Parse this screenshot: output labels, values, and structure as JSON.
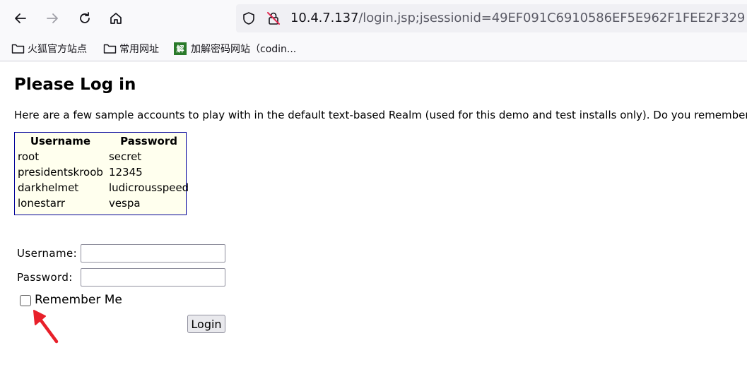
{
  "browser": {
    "url_host": "10.4.7.137",
    "url_path": "/login.jsp;jsessionid=49EF091C6910586EF5E962F1FEE2F329",
    "bookmarks": [
      {
        "label": "火狐官方站点",
        "icon": "folder-icon"
      },
      {
        "label": "常用网址",
        "icon": "folder-icon"
      },
      {
        "label": "加解密码网站（codin...",
        "icon": "site-favicon",
        "favicon_text": "解"
      }
    ]
  },
  "page": {
    "title": "Please Log in",
    "intro": "Here are a few sample accounts to play with in the default text-based Realm (used for this demo and test installs only). Do you remember",
    "accounts_table": {
      "headers": [
        "Username",
        "Password"
      ],
      "rows": [
        [
          "root",
          "secret"
        ],
        [
          "presidentskroob",
          "12345"
        ],
        [
          "darkhelmet",
          "ludicrousspeed"
        ],
        [
          "lonestarr",
          "vespa"
        ]
      ]
    },
    "form": {
      "username_label": "Username:",
      "username_value": "",
      "password_label": "Password:",
      "password_value": "",
      "remember_label": "Remember Me",
      "remember_checked": false,
      "login_label": "Login"
    }
  },
  "colors": {
    "table_border": "#000099",
    "table_background": "#ffffee",
    "annotation_arrow": "#e8202a"
  }
}
